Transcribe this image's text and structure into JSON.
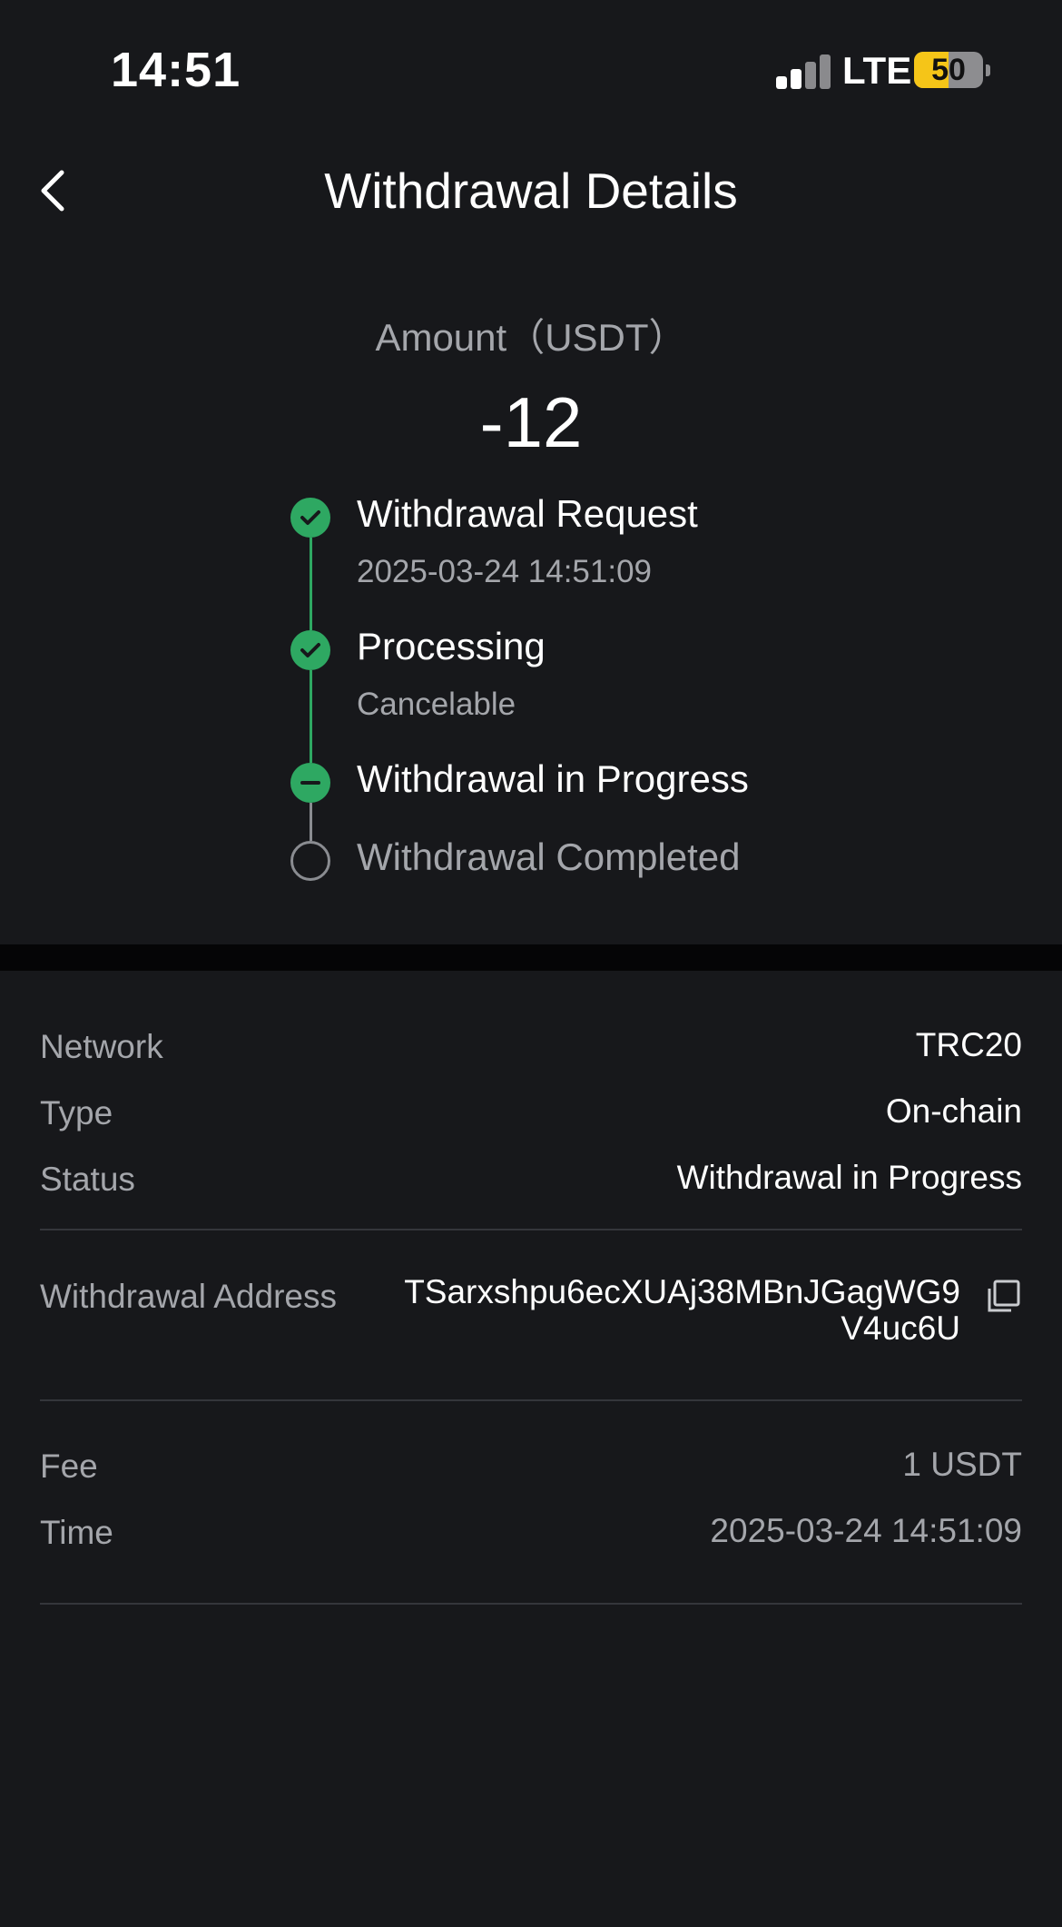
{
  "status_bar": {
    "time": "14:51",
    "network": "LTE",
    "battery_level": "50"
  },
  "header": {
    "back_icon": "chevron-left-icon",
    "title": "Withdrawal Details"
  },
  "amount": {
    "label": "Amount（USDT）",
    "value": "-12"
  },
  "timeline": [
    {
      "title": "Withdrawal Request",
      "subtitle": "2025-03-24 14:51:09",
      "state": "done"
    },
    {
      "title": "Processing",
      "subtitle": "Cancelable",
      "state": "done"
    },
    {
      "title": "Withdrawal in Progress",
      "subtitle": "",
      "state": "current"
    },
    {
      "title": "Withdrawal Completed",
      "subtitle": "",
      "state": "pending"
    }
  ],
  "details": {
    "network": {
      "label": "Network",
      "value": "TRC20"
    },
    "type": {
      "label": "Type",
      "value": "On-chain"
    },
    "status": {
      "label": "Status",
      "value": "Withdrawal in Progress"
    },
    "address": {
      "label": "Withdrawal Address",
      "value": "TSarxshpu6ecXUAj38MBnJGagWG9V4uc6U",
      "copy_icon": "copy-icon"
    },
    "fee": {
      "label": "Fee",
      "value": "1 USDT"
    },
    "time": {
      "label": "Time",
      "value": "2025-03-24 14:51:09"
    }
  },
  "colors": {
    "background": "#17181b",
    "accent_green": "#2ea862",
    "muted_text": "#a4a6ab",
    "battery": "#f5c518"
  }
}
